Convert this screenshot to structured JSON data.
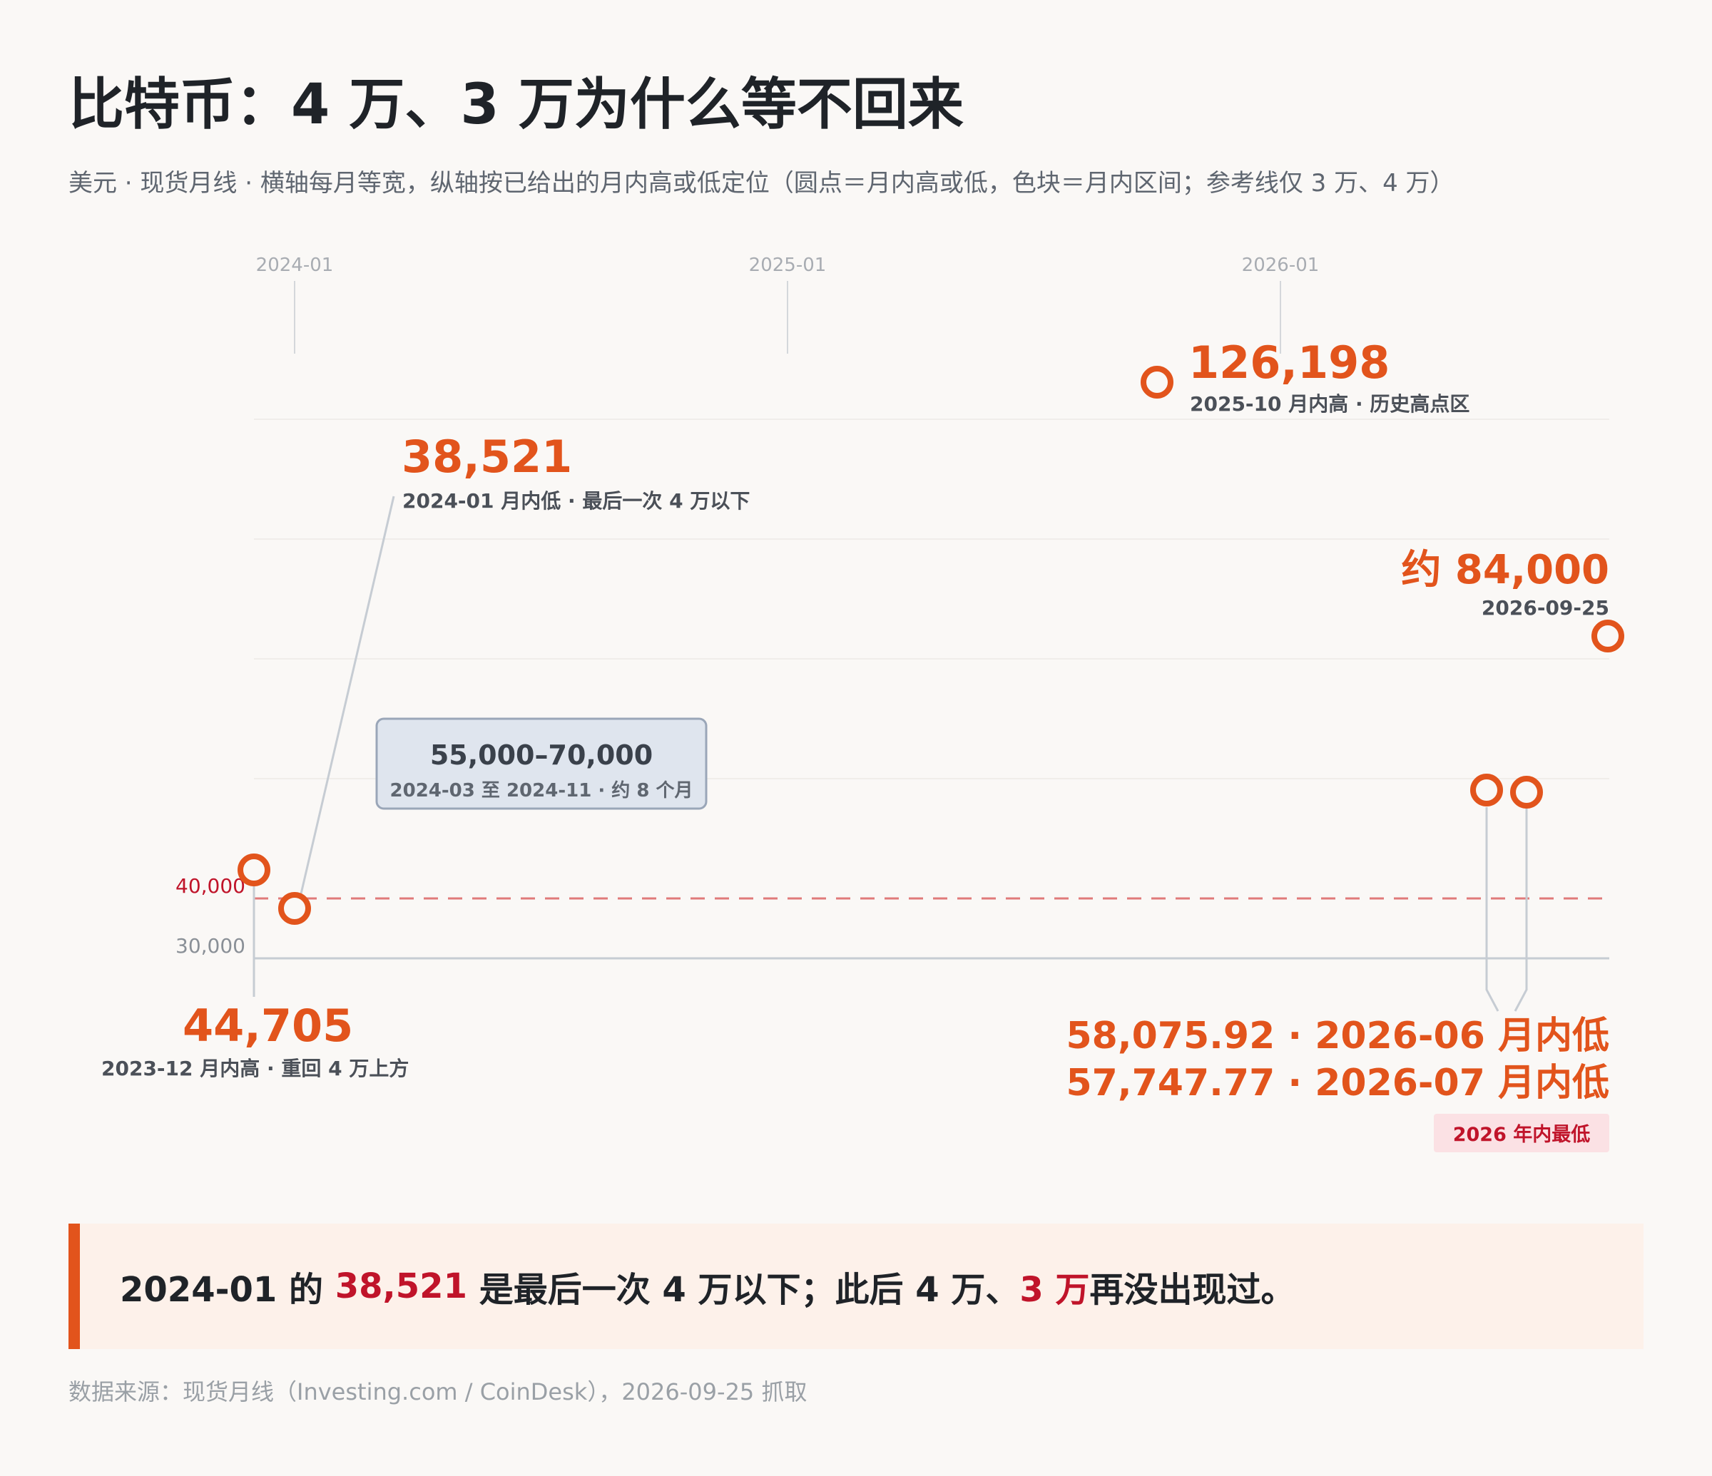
{
  "title": "比特币：4 万、3 万为什么等不回来",
  "subtitle": "美元 · 现货月线 · 横轴每月等宽，纵轴按已给出的月内高或低定位（圆点＝月内高或低，色块＝月内区间；参考线仅 3 万、4 万）",
  "colors": {
    "accent": "#e2541c",
    "red": "#c0142a",
    "range_fill": "#dfe5ee",
    "range_stroke": "#9aa6b8"
  },
  "chart_data": {
    "type": "scatter",
    "x_ticks": [
      "2024-01",
      "2025-01",
      "2026-01"
    ],
    "ref_lines": [
      {
        "value": 30000,
        "label": "30,000",
        "style": "solid"
      },
      {
        "value": 40000,
        "label": "40,000",
        "style": "dashed"
      }
    ],
    "points": [
      {
        "month": "2023-12",
        "value": 44705,
        "label": "44,705",
        "note": "2023-12 月内高 · 重回 4 万上方"
      },
      {
        "month": "2024-01",
        "value": 38521,
        "label": "38,521",
        "note": "2024-01 月内低 · 最后一次 4 万以下"
      },
      {
        "month": "2025-10",
        "value": 126198,
        "label": "126,198",
        "note": "2025-10 月内高 · 历史高点区"
      },
      {
        "month": "2026-06",
        "value": 58075.92,
        "label": "58,075.92 · 2026-06 月内低"
      },
      {
        "month": "2026-07",
        "value": 57747.77,
        "label": "57,747.77 · 2026-07 月内低"
      },
      {
        "month": "2026-09",
        "value": 84000,
        "label": "约 84,000",
        "note": "2026-09-25"
      }
    ],
    "range_band": {
      "low": 55000,
      "high": 70000,
      "label": "55,000–70,000",
      "note": "2024-03 至 2024-11 · 约 8 个月"
    },
    "badge": "2026 年内最低"
  },
  "callout": {
    "p1": "2024-01 的 ",
    "h1": "38,521",
    "p2": " 是最后一次 4 万以下；此后 4 万、",
    "h2": "3 万",
    "p3": "再没出现过。"
  },
  "source": "数据来源：现货月线（Investing.com / CoinDesk），2026-09-25 抓取"
}
